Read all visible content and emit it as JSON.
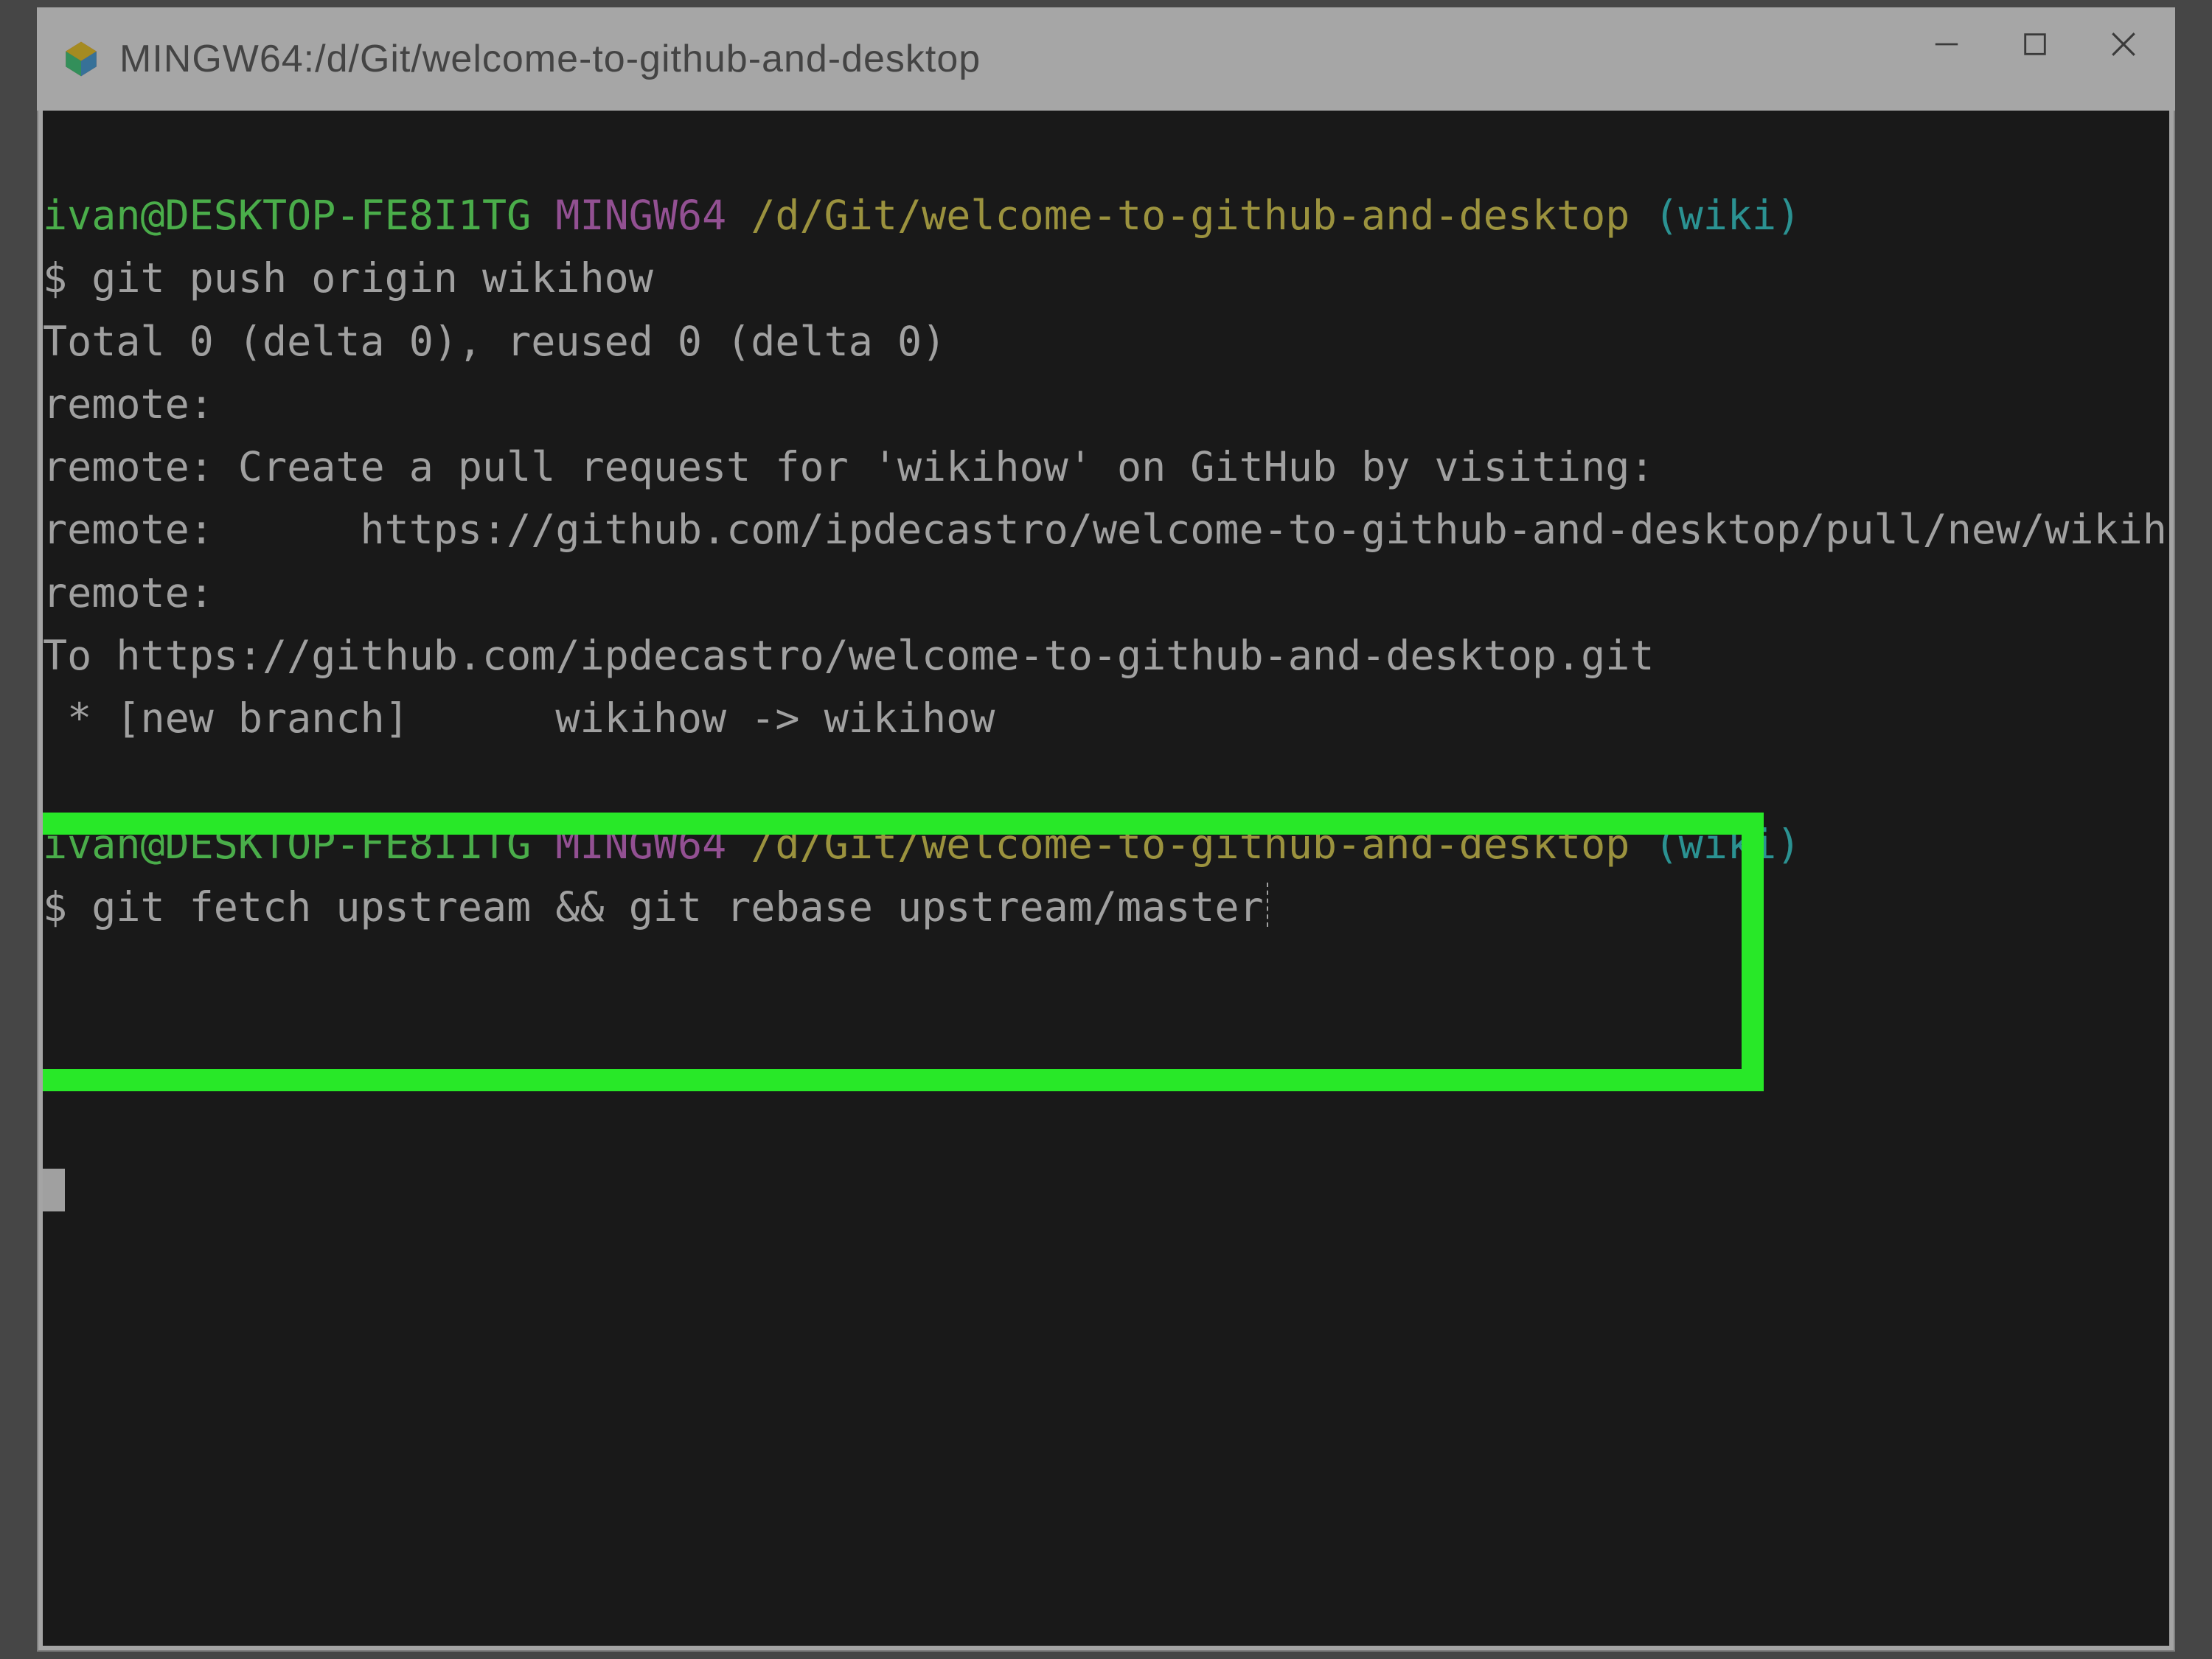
{
  "window": {
    "title": "MINGW64:/d/Git/welcome-to-github-and-desktop"
  },
  "colors": {
    "highlight": "#28e828",
    "user": "#55ff55",
    "mingw": "#d060d0",
    "path": "#e0d040",
    "branch": "#20d0d0"
  },
  "prompt1": {
    "user": "ivan@DESKTOP-FE8I1TG",
    "env": "MINGW64",
    "path": "/d/Git/welcome-to-github-and-desktop",
    "branch": "(wiki)",
    "command": "$ git push origin wikihow"
  },
  "output": {
    "l1": "Total 0 (delta 0), reused 0 (delta 0)",
    "l2": "remote:",
    "l3": "remote: Create a pull request for 'wikihow' on GitHub by visiting:",
    "l4": "remote:      https://github.com/ipdecastro/welcome-to-github-and-desktop/pull/new/wikihow",
    "l5": "remote:",
    "l6": "To https://github.com/ipdecastro/welcome-to-github-and-desktop.git",
    "l7": " * [new branch]      wikihow -> wikihow"
  },
  "prompt2": {
    "user": "ivan@DESKTOP-FE8I1TG",
    "env": "MINGW64",
    "path": "/d/Git/welcome-to-github-and-desktop",
    "branch": "(wiki)",
    "command": "$ git fetch upstream && git rebase upstream/master"
  }
}
